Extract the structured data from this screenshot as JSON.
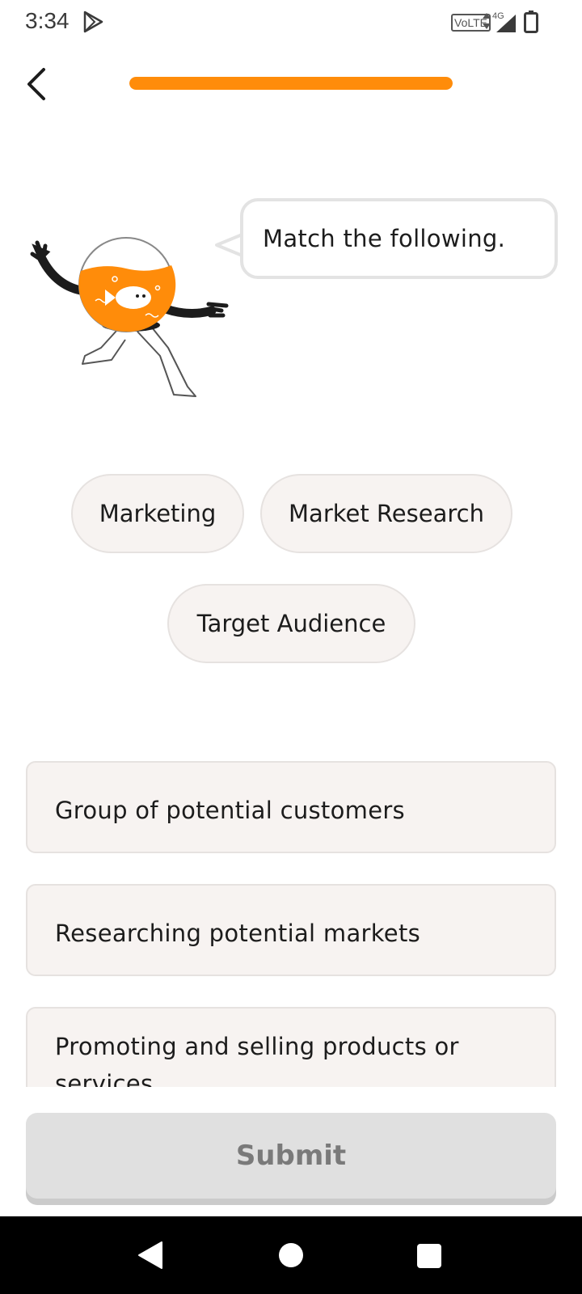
{
  "status_bar": {
    "time": "3:34",
    "volte": "VoLTE",
    "network": "4G"
  },
  "header": {
    "back_icon": "chevron-left-icon",
    "progress_percent": 100
  },
  "prompt": {
    "text": "Match the following."
  },
  "terms": [
    {
      "label": "Marketing"
    },
    {
      "label": "Market Research"
    },
    {
      "label": "Target Audience"
    }
  ],
  "definitions": [
    {
      "text": "Group of potential customers"
    },
    {
      "text": "Researching potential markets"
    },
    {
      "text": "Promoting and selling products or services"
    }
  ],
  "submit": {
    "label": "Submit"
  },
  "colors": {
    "accent": "#ff8c0a",
    "chip_bg": "#f7f3f1",
    "disabled_button": "#e0e0e0"
  }
}
